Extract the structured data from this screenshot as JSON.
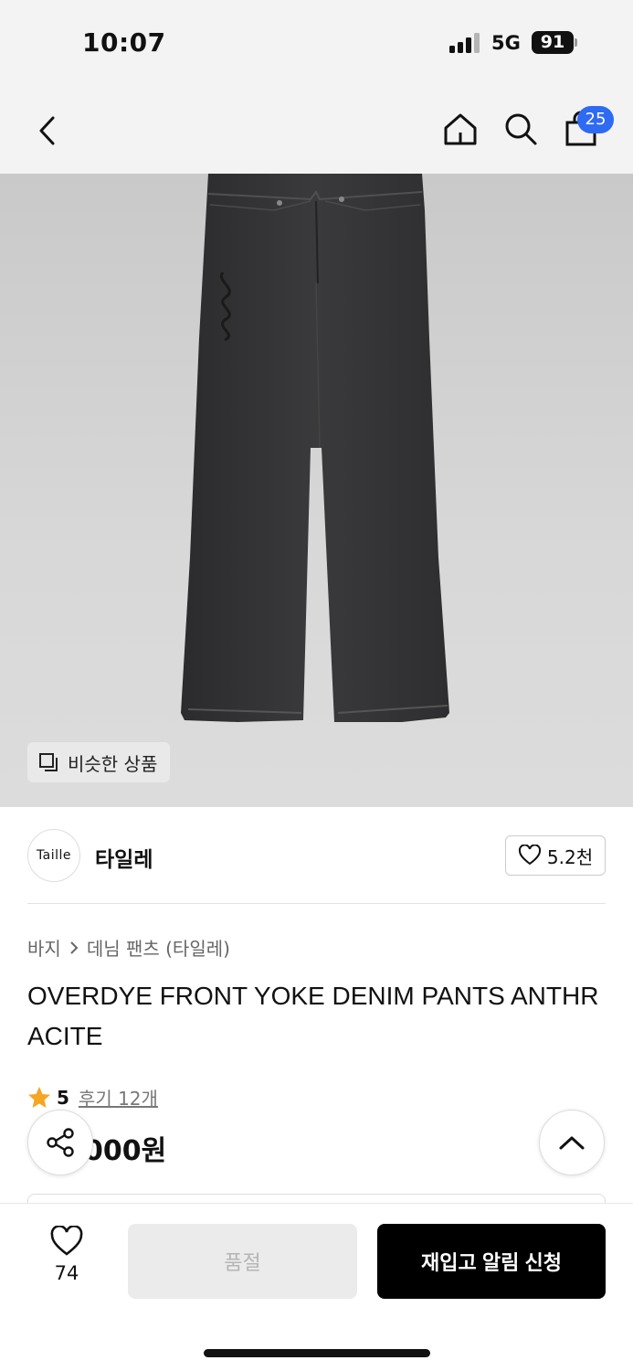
{
  "status_bar": {
    "time": "10:07",
    "network": "5G",
    "battery": "91"
  },
  "nav": {
    "cart_count": "25"
  },
  "product_image": {
    "similar_label": "비슷한 상품"
  },
  "brand": {
    "logo_text": "Taille",
    "name": "타일레",
    "likes": "5.2천"
  },
  "breadcrumb": {
    "category": "바지",
    "subcategory": "데님 팬츠 (타일레)"
  },
  "product": {
    "title": "OVERDYE FRONT YOKE DENIM PANTS ANTHRACITE",
    "rating": "5",
    "reviews": "후기 12개",
    "price": "000원"
  },
  "bottom_bar": {
    "wish_count": "74",
    "soldout_label": "품절",
    "restock_label": "재입고 알림 신청"
  },
  "colors": {
    "accent": "#2e6af2",
    "star": "#f5a623",
    "primary_button": "#000000"
  }
}
